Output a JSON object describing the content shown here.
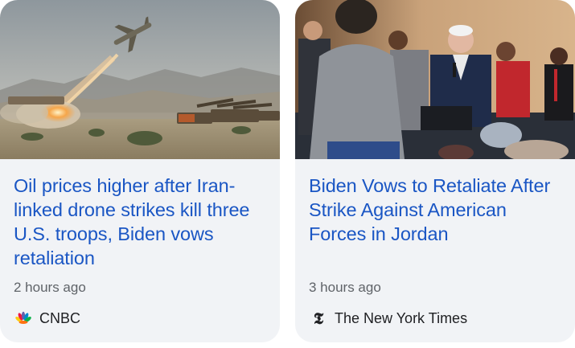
{
  "cards": [
    {
      "headline": "Oil prices higher after Iran-linked drone strikes kill three U.S. troops, Biden vows retaliation",
      "time": "2 hours ago",
      "source": "CNBC",
      "source_icon": "cnbc-peacock-logo",
      "image_subject": "drone-launch-photo"
    },
    {
      "headline": "Biden Vows to Retaliate After Strike Against American Forces in Jordan",
      "time": "3 hours ago",
      "source": "The New York Times",
      "source_icon": "nyt-logo",
      "source_icon_glyph": "𝕿",
      "image_subject": "speaker-at-podium-photo"
    }
  ],
  "colors": {
    "headline": "#1a56c4",
    "card_bg": "#f1f3f6",
    "meta_text": "#5f6368"
  }
}
